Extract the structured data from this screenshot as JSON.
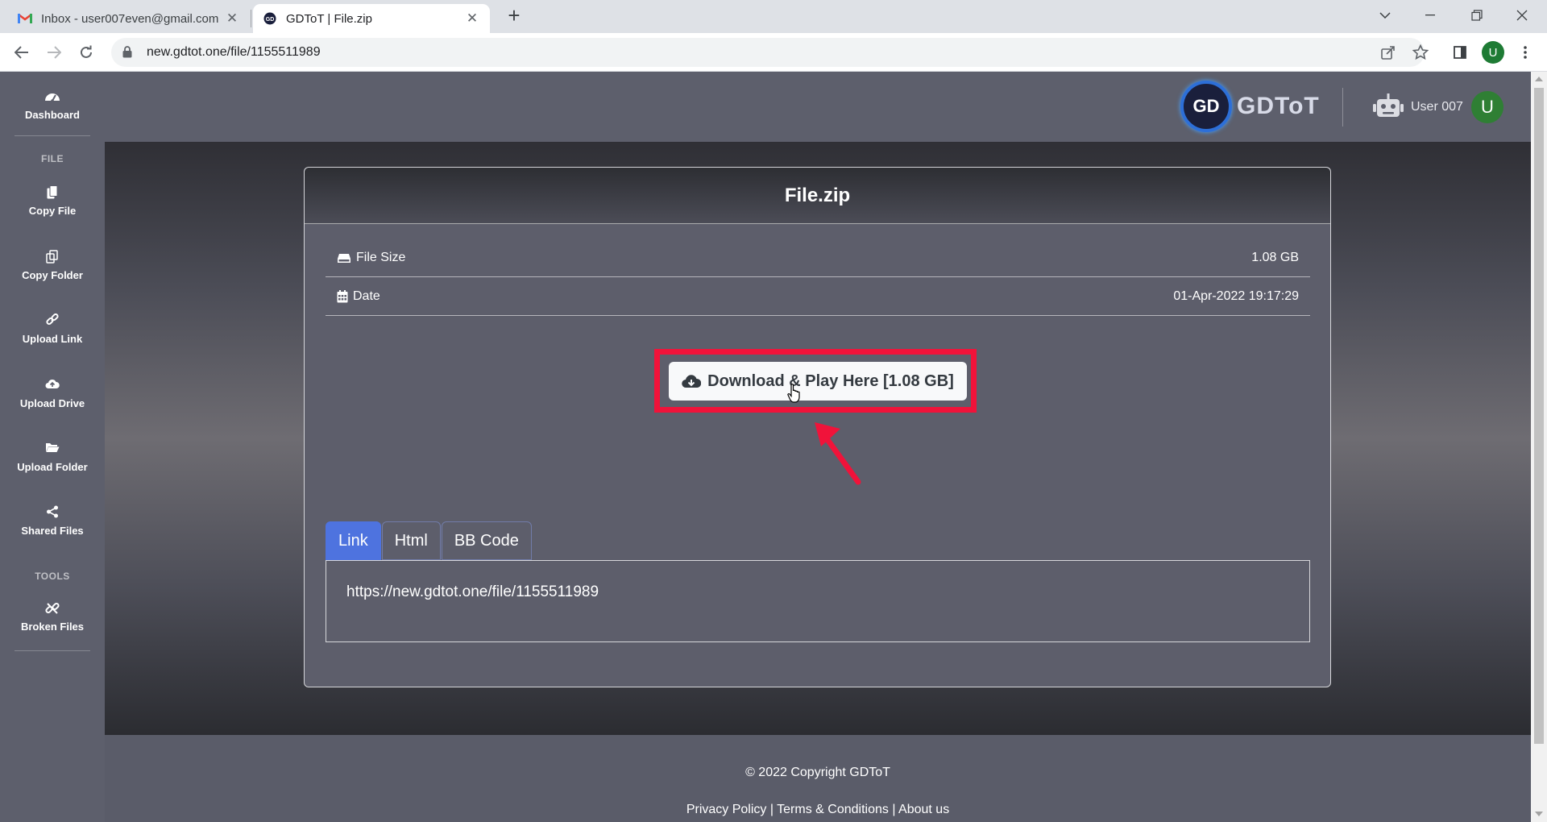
{
  "browser": {
    "tabs": [
      {
        "title": "Inbox - user007even@gmail.com",
        "icon": "gmail-icon",
        "active": false
      },
      {
        "title": "GDToT | File.zip",
        "icon": "gdtot-favicon",
        "active": true
      }
    ],
    "url": "new.gdtot.one/file/1155511989",
    "profile_initial": "U"
  },
  "sidebar": {
    "items": [
      {
        "label": "Dashboard",
        "icon": "dashboard-icon"
      },
      {
        "label": "Copy File",
        "icon": "copy-file-icon"
      },
      {
        "label": "Copy Folder",
        "icon": "copy-folder-icon"
      },
      {
        "label": "Upload Link",
        "icon": "link-icon"
      },
      {
        "label": "Upload Drive",
        "icon": "cloud-upload-icon"
      },
      {
        "label": "Upload Folder",
        "icon": "folder-open-icon"
      },
      {
        "label": "Shared Files",
        "icon": "share-icon"
      },
      {
        "label": "Broken Files",
        "icon": "broken-link-icon"
      }
    ],
    "headings": {
      "file": "FILE",
      "tools": "TOOLS"
    }
  },
  "topbar": {
    "logo_badge": "GD",
    "logo_text": "GDToT",
    "user_name": "User 007",
    "user_initial": "U"
  },
  "file": {
    "title": "File.zip",
    "size_label": "File Size",
    "size_value": "1.08 GB",
    "date_label": "Date",
    "date_value": "01-Apr-2022 19:17:29",
    "download_label": "Download & Play Here [1.08 GB]"
  },
  "share": {
    "tabs": [
      "Link",
      "Html",
      "BB Code"
    ],
    "active_tab": "Link",
    "link_value": "https://new.gdtot.one/file/1155511989"
  },
  "footer": {
    "copyright": "© 2022 Copyright GDToT",
    "links": "Privacy Policy | Terms & Conditions | About us"
  },
  "colors": {
    "accent": "#4e73df",
    "highlight": "#f0133a",
    "page_bg": "#5a5c69"
  }
}
